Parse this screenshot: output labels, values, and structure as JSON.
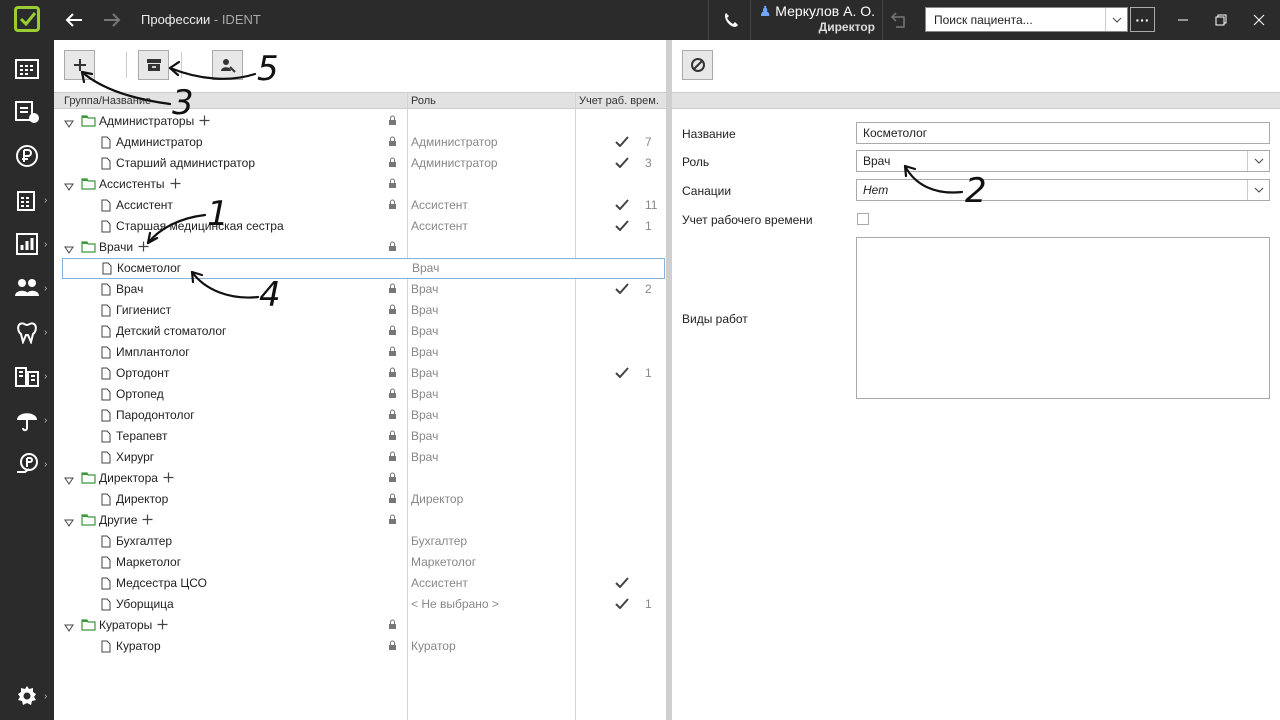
{
  "app": {
    "title": "Профессии",
    "app_name": " - IDENT",
    "user_name": "Меркулов А. О.",
    "user_role": "Директор",
    "search_placeholder": "Поиск пациента...",
    "more": "···"
  },
  "columns": {
    "group": "Группа/Название",
    "role": "Роль",
    "time": "Учет раб. врем."
  },
  "rows": [
    {
      "type": "group",
      "name": "Администраторы",
      "role": "",
      "check": false,
      "count": "",
      "lock": true
    },
    {
      "type": "item",
      "name": "Администратор",
      "role": "Администратор",
      "check": true,
      "count": "7",
      "lock": true
    },
    {
      "type": "item",
      "name": "Старший администратор",
      "role": "Администратор",
      "check": true,
      "count": "3",
      "lock": true
    },
    {
      "type": "group",
      "name": "Ассистенты",
      "role": "",
      "check": false,
      "count": "",
      "lock": true
    },
    {
      "type": "item",
      "name": "Ассистент",
      "role": "Ассистент",
      "check": true,
      "count": "11",
      "lock": true
    },
    {
      "type": "item",
      "name": "Старшая медицинская сестра",
      "role": "Ассистент",
      "check": true,
      "count": "1",
      "lock": false
    },
    {
      "type": "group",
      "name": "Врачи",
      "role": "",
      "check": false,
      "count": "",
      "lock": true
    },
    {
      "type": "item",
      "name": "Косметолог",
      "role": "Врач",
      "check": false,
      "count": "",
      "lock": false,
      "selected": true
    },
    {
      "type": "item",
      "name": "Врач",
      "role": "Врач",
      "check": true,
      "count": "2",
      "lock": true
    },
    {
      "type": "item",
      "name": "Гигиенист",
      "role": "Врач",
      "check": false,
      "count": "",
      "lock": true
    },
    {
      "type": "item",
      "name": "Детский стоматолог",
      "role": "Врач",
      "check": false,
      "count": "",
      "lock": true
    },
    {
      "type": "item",
      "name": "Имплантолог",
      "role": "Врач",
      "check": false,
      "count": "",
      "lock": true
    },
    {
      "type": "item",
      "name": "Ортодонт",
      "role": "Врач",
      "check": true,
      "count": "1",
      "lock": true
    },
    {
      "type": "item",
      "name": "Ортопед",
      "role": "Врач",
      "check": false,
      "count": "",
      "lock": true
    },
    {
      "type": "item",
      "name": "Пародонтолог",
      "role": "Врач",
      "check": false,
      "count": "",
      "lock": true
    },
    {
      "type": "item",
      "name": "Терапевт",
      "role": "Врач",
      "check": false,
      "count": "",
      "lock": true
    },
    {
      "type": "item",
      "name": "Хирург",
      "role": "Врач",
      "check": false,
      "count": "",
      "lock": true
    },
    {
      "type": "group",
      "name": "Директора",
      "role": "",
      "check": false,
      "count": "",
      "lock": true
    },
    {
      "type": "item",
      "name": "Директор",
      "role": "Директор",
      "check": false,
      "count": "",
      "lock": true
    },
    {
      "type": "group",
      "name": "Другие",
      "role": "",
      "check": false,
      "count": "",
      "lock": true
    },
    {
      "type": "item",
      "name": "Бухгалтер",
      "role": "Бухгалтер",
      "check": false,
      "count": "",
      "lock": false
    },
    {
      "type": "item",
      "name": "Маркетолог",
      "role": "Маркетолог",
      "check": false,
      "count": "",
      "lock": false
    },
    {
      "type": "item",
      "name": "Медсестра ЦСО",
      "role": "Ассистент",
      "check": true,
      "count": "",
      "lock": false
    },
    {
      "type": "item",
      "name": "Уборщица",
      "role": "< Не выбрано >",
      "check": true,
      "count": "1",
      "lock": false
    },
    {
      "type": "group",
      "name": "Кураторы",
      "role": "",
      "check": false,
      "count": "",
      "lock": true
    },
    {
      "type": "item",
      "name": "Куратор",
      "role": "Куратор",
      "check": false,
      "count": "",
      "lock": true
    }
  ],
  "form": {
    "name_label": "Название",
    "name_value": "Косметолог",
    "role_label": "Роль",
    "role_value": "Врач",
    "sanction_label": "Санации",
    "sanction_value": "Нет",
    "time_label": "Учет рабочего времени",
    "time_checked": false,
    "works_label": "Виды работ"
  },
  "annotations": [
    "1",
    "2",
    "3",
    "4",
    "5"
  ],
  "colors": {
    "titlebar": "#2b2b2b",
    "accent_green": "#9acd32",
    "selection_border": "#8ab0dc",
    "folder_green": "#3a9a3a"
  }
}
